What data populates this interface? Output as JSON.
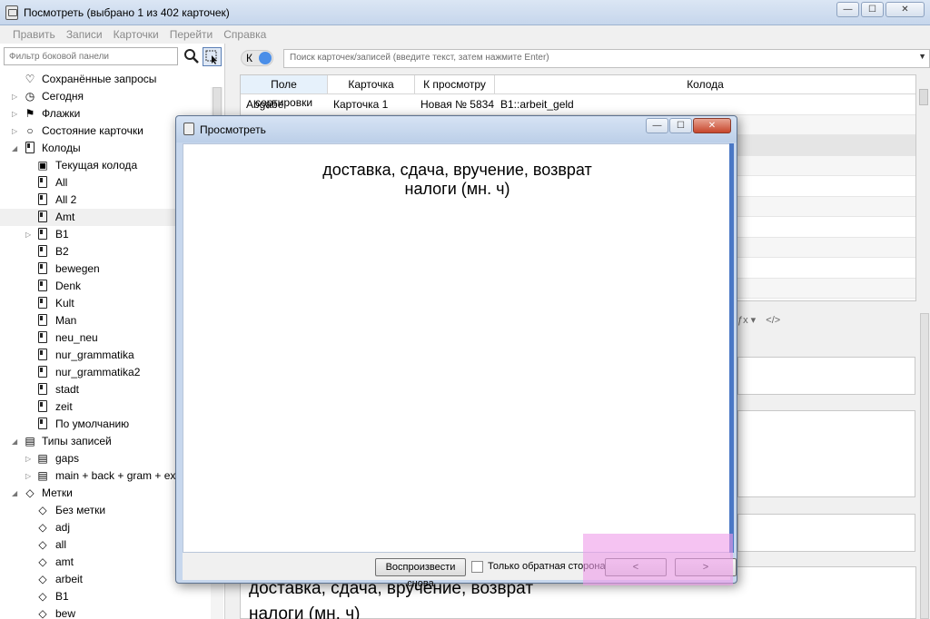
{
  "window": {
    "title": "Посмотреть (выбрано 1 из 402 карточек)"
  },
  "menu": {
    "items": [
      "Править",
      "Записи",
      "Карточки",
      "Перейти",
      "Справка"
    ]
  },
  "sidebar": {
    "filter_placeholder": "Фильтр боковой панели",
    "items": [
      {
        "label": "Сохранённые запросы",
        "icon": "heart-icon"
      },
      {
        "label": "Сегодня",
        "icon": "clock-icon"
      },
      {
        "label": "Флажки",
        "icon": "flag-icon"
      },
      {
        "label": "Состояние карточки",
        "icon": "circle-icon"
      },
      {
        "label": "Колоды",
        "icon": "deck-icon"
      },
      {
        "label": "Текущая колода",
        "icon": "current-deck-icon"
      },
      {
        "label": "All",
        "icon": "deck-icon"
      },
      {
        "label": "All 2",
        "icon": "deck-icon"
      },
      {
        "label": "Amt",
        "icon": "deck-icon"
      },
      {
        "label": "B1",
        "icon": "deck-icon"
      },
      {
        "label": "B2",
        "icon": "deck-icon"
      },
      {
        "label": "bewegen",
        "icon": "deck-icon"
      },
      {
        "label": "Denk",
        "icon": "deck-icon"
      },
      {
        "label": "Kult",
        "icon": "deck-icon"
      },
      {
        "label": "Man",
        "icon": "deck-icon"
      },
      {
        "label": "neu_neu",
        "icon": "deck-icon"
      },
      {
        "label": "nur_grammatika",
        "icon": "deck-icon"
      },
      {
        "label": "nur_grammatika2",
        "icon": "deck-icon"
      },
      {
        "label": "stadt",
        "icon": "deck-icon"
      },
      {
        "label": "zeit",
        "icon": "deck-icon"
      },
      {
        "label": "По умолчанию",
        "icon": "deck-icon"
      },
      {
        "label": "Типы записей",
        "icon": "note-type-icon"
      },
      {
        "label": "gaps",
        "icon": "note-type-icon"
      },
      {
        "label": "main + back + gram + exa",
        "icon": "note-type-icon"
      },
      {
        "label": "Метки",
        "icon": "tag-icon"
      },
      {
        "label": "Без метки",
        "icon": "tag-icon"
      },
      {
        "label": "adj",
        "icon": "tag-icon"
      },
      {
        "label": "all",
        "icon": "tag-icon"
      },
      {
        "label": "amt",
        "icon": "tag-icon"
      },
      {
        "label": "arbeit",
        "icon": "tag-icon"
      },
      {
        "label": "B1",
        "icon": "tag-icon"
      },
      {
        "label": "bew",
        "icon": "tag-icon"
      }
    ]
  },
  "toolbar": {
    "toggle_label": "К",
    "search_placeholder": "Поиск карточек/записей (введите текст, затем нажмите Enter)"
  },
  "table": {
    "columns": [
      "Поле сортировки",
      "Карточка",
      "К просмотру",
      "Колода"
    ],
    "rows": [
      [
        "Abgabe",
        "Карточка 1",
        "Новая № 5834",
        "B1::arbeit_geld"
      ],
      [
        "",
        "",
        "",
        ""
      ],
      [
        "",
        "",
        "",
        ""
      ],
      [
        "",
        "",
        "",
        ""
      ],
      [
        "",
        "",
        "",
        ""
      ],
      [
        "",
        "",
        "",
        ""
      ],
      [
        "",
        "",
        "",
        ""
      ],
      [
        "",
        "",
        "",
        ""
      ],
      [
        "",
        "",
        "",
        ""
      ],
      [
        "",
        "",
        "",
        ""
      ]
    ]
  },
  "editor": {
    "bottom_field_line1": "доставка, сдача, вручение, возврат",
    "bottom_field_line2": "налоги (мн. ч)"
  },
  "preview": {
    "title": "Просмотреть",
    "line1": "доставка, сдача, вручение, возврат",
    "line2": "налоги (мн. ч)",
    "replay_label": "Воспроизвести снова",
    "back_only_label": "Только обратная сторона",
    "prev_label": "<",
    "next_label": ">"
  },
  "colors": {
    "accent": "#4a8ee8",
    "highlight": "#ef9bea"
  }
}
